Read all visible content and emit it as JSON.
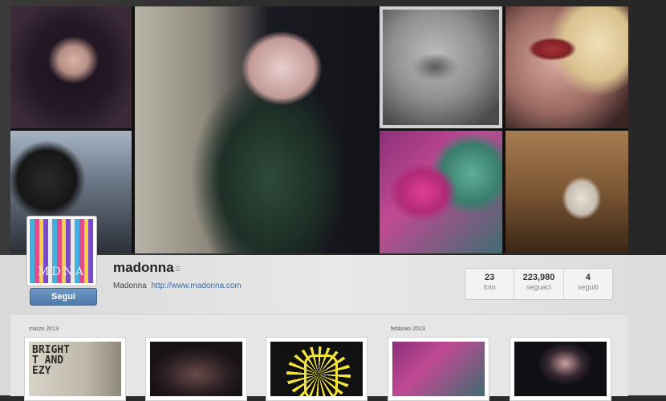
{
  "profile": {
    "username": "madonna",
    "full_name": "Madonna",
    "website": "http://www.madonna.com",
    "avatar_text": "MDNA",
    "follow_label": "Segui"
  },
  "stats": [
    {
      "value": "23",
      "label": "foto"
    },
    {
      "value": "223,980",
      "label": "seguaci"
    },
    {
      "value": "4",
      "label": "seguiti"
    }
  ],
  "feed": {
    "months": [
      "marzo 2013",
      "febbraio 2013"
    ],
    "thumb_text": "BRIGHT\nT AND\nEZY"
  },
  "colors": {
    "follow_button": "#4f79a8",
    "link": "#3b6ea5"
  },
  "icons": {
    "menu": "menu-icon"
  }
}
